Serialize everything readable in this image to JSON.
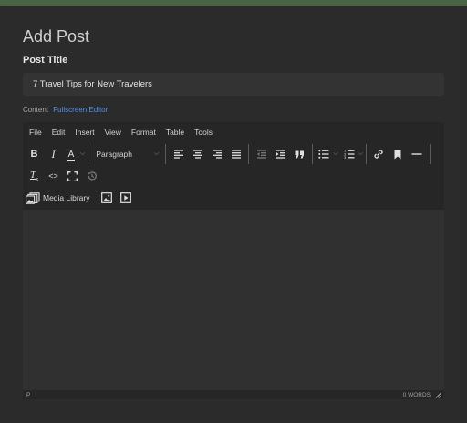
{
  "header": {
    "title": "Add Post"
  },
  "post_title": {
    "label": "Post Title",
    "value": "7 Travel Tips for New Travelers"
  },
  "content": {
    "label": "Content",
    "fullscreen_link": "Fullscreen Editor"
  },
  "menubar": {
    "items": [
      "File",
      "Edit",
      "Insert",
      "View",
      "Format",
      "Table",
      "Tools"
    ]
  },
  "toolbar": {
    "bold": "B",
    "italic": "I",
    "text_color": "A",
    "block_format": "Paragraph",
    "clear_format": "T",
    "code": "<>",
    "media_library": "Media Library"
  },
  "status": {
    "path": "P",
    "word_count": "0 WORDS"
  },
  "colors": {
    "accent_link": "#4f8fe6",
    "top_strip": "#4a6343",
    "background": "#2b2b2b"
  }
}
